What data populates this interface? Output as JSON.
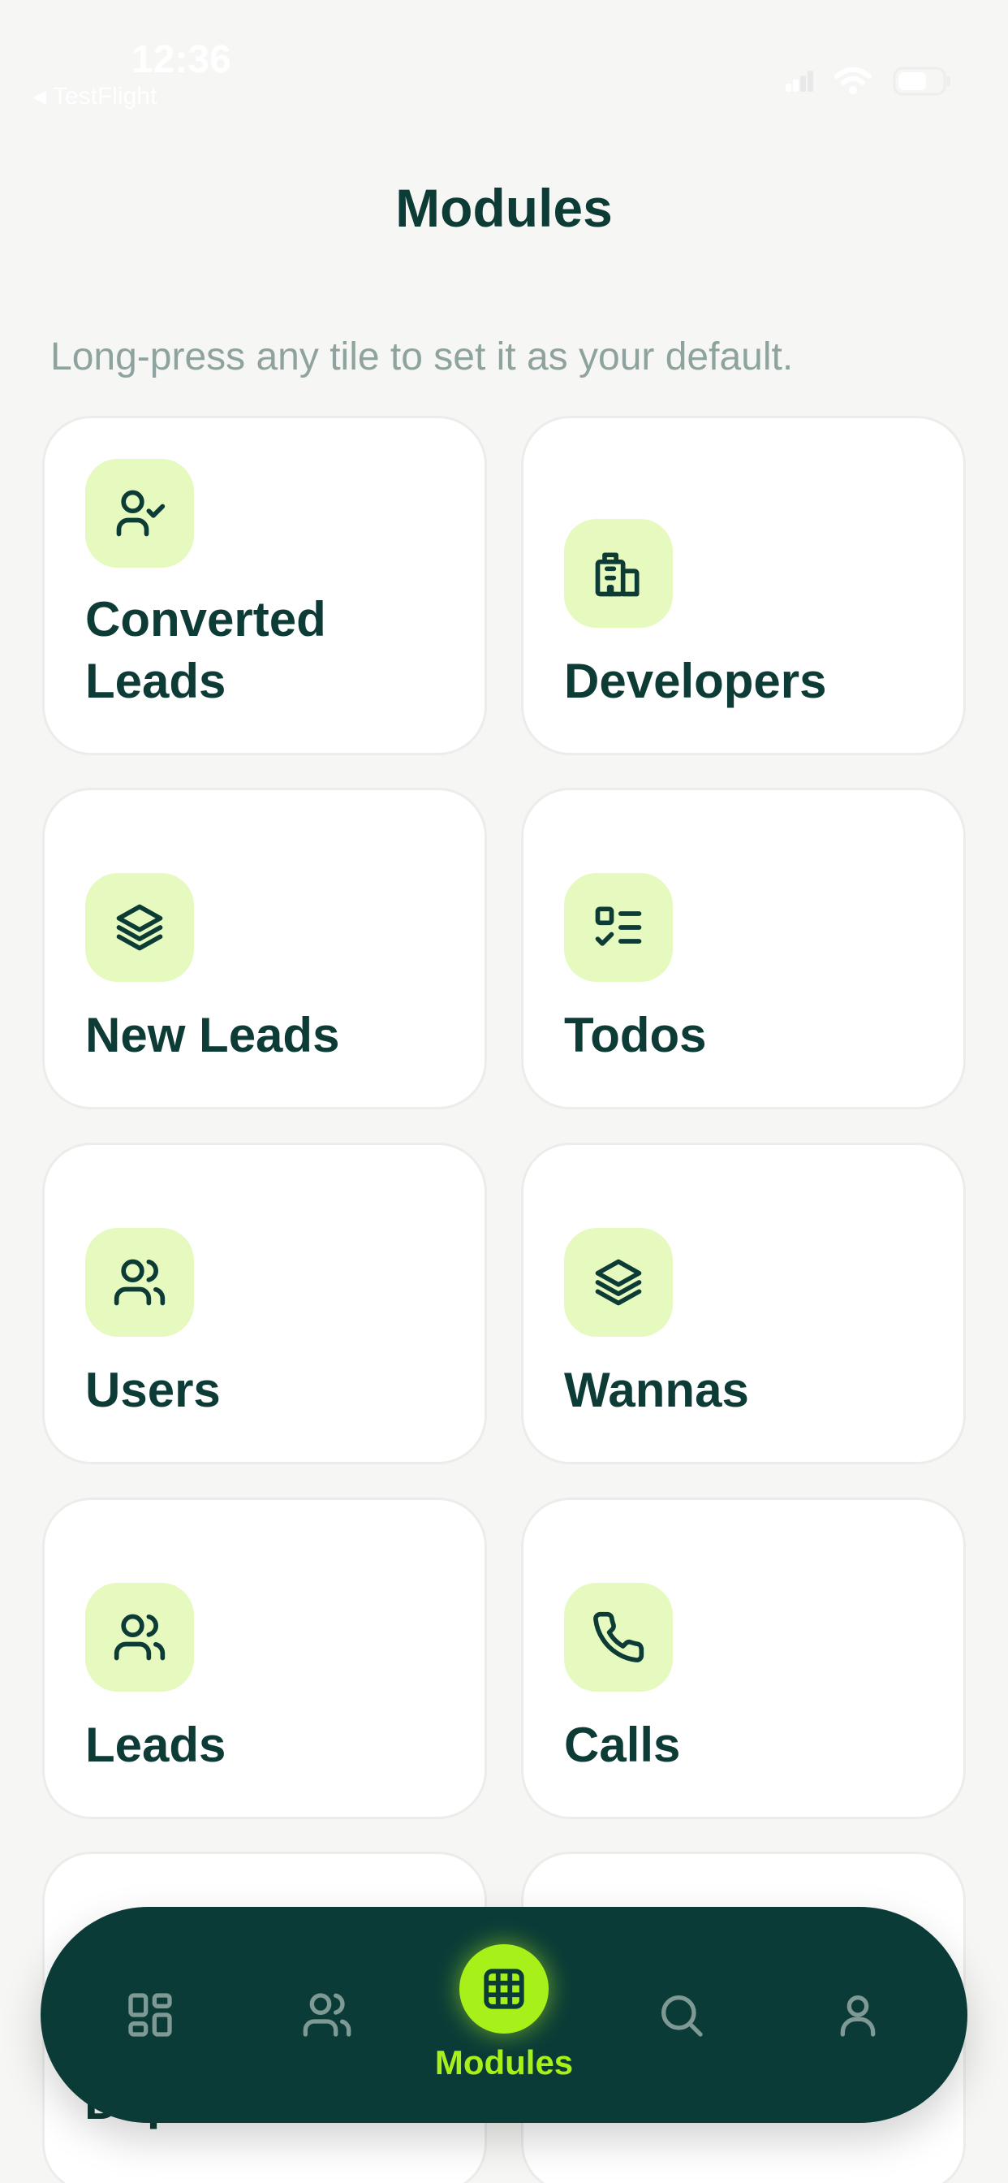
{
  "status_bar": {
    "time": "12:36",
    "back_app": "TestFlight"
  },
  "header": {
    "title": "Modules",
    "hint": "Long-press any tile to set it as your default."
  },
  "tiles": [
    {
      "label": "Converted Leads",
      "icon": "user-check-icon"
    },
    {
      "label": "Developers",
      "icon": "building-icon"
    },
    {
      "label": "New Leads",
      "icon": "layers-icon"
    },
    {
      "label": "Todos",
      "icon": "checklist-icon"
    },
    {
      "label": "Users",
      "icon": "users-icon"
    },
    {
      "label": "Wannas",
      "icon": "layers-icon"
    },
    {
      "label": "Leads",
      "icon": "users-icon"
    },
    {
      "label": "Calls",
      "icon": "phone-icon"
    }
  ],
  "peek": {
    "label": "Dep"
  },
  "bottom_nav": {
    "items": [
      {
        "name": "dashboard",
        "icon": "dashboard-icon"
      },
      {
        "name": "contacts",
        "icon": "users-icon"
      },
      {
        "name": "modules",
        "icon": "grid-icon",
        "label": "Modules",
        "active": true
      },
      {
        "name": "search",
        "icon": "search-icon"
      },
      {
        "name": "profile",
        "icon": "user-icon"
      }
    ]
  },
  "colors": {
    "background": "#f6f6f4",
    "primary_text": "#0d3b36",
    "hint_text": "#8ea39d",
    "icon_bg": "#e6fac0",
    "nav_bg": "#0b3b37",
    "accent": "#a8f01a"
  }
}
